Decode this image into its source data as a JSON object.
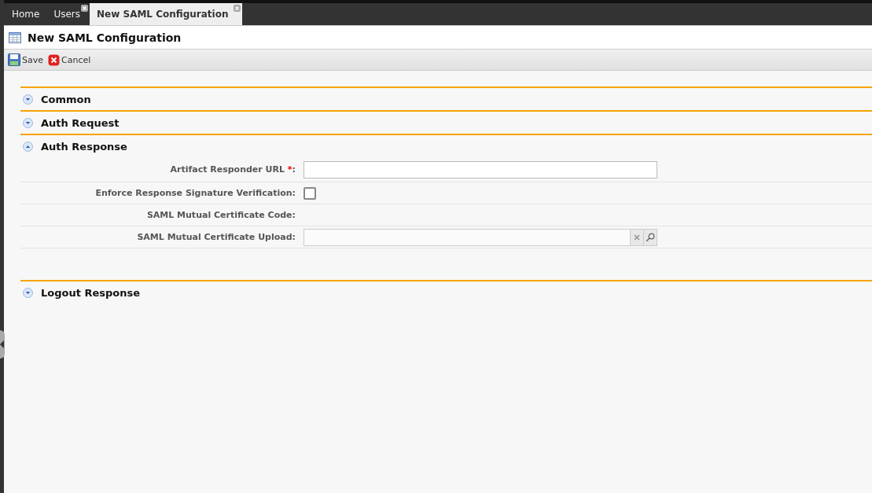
{
  "tabs": [
    {
      "label": "Home",
      "selected": false,
      "closable": false
    },
    {
      "label": "Users",
      "selected": false,
      "closable": true
    },
    {
      "label": "New SAML Configuration",
      "selected": true,
      "closable": true
    }
  ],
  "page_title": "New SAML Configuration",
  "toolbar": [
    {
      "kind": "save",
      "label": "Save"
    },
    {
      "kind": "cancel",
      "label": "Cancel"
    }
  ],
  "sections": [
    {
      "title": "Common",
      "expanded": false
    },
    {
      "title": "Auth Request",
      "expanded": false
    },
    {
      "title": "Auth Response",
      "expanded": true,
      "fields": [
        {
          "kind": "text",
          "label": "Artifact Responder URL",
          "required_mark": "*",
          "separator": ":"
        },
        {
          "kind": "checkbox",
          "label": "Enforce Response Signature Verification",
          "separator": ":",
          "checked": false
        },
        {
          "kind": "readonly",
          "label": "SAML Mutual Certificate Code",
          "separator": ":"
        },
        {
          "kind": "upload",
          "label": "SAML Mutual Certificate Upload",
          "separator": ":"
        }
      ]
    },
    {
      "title": "Logout Response",
      "expanded": false
    }
  ]
}
